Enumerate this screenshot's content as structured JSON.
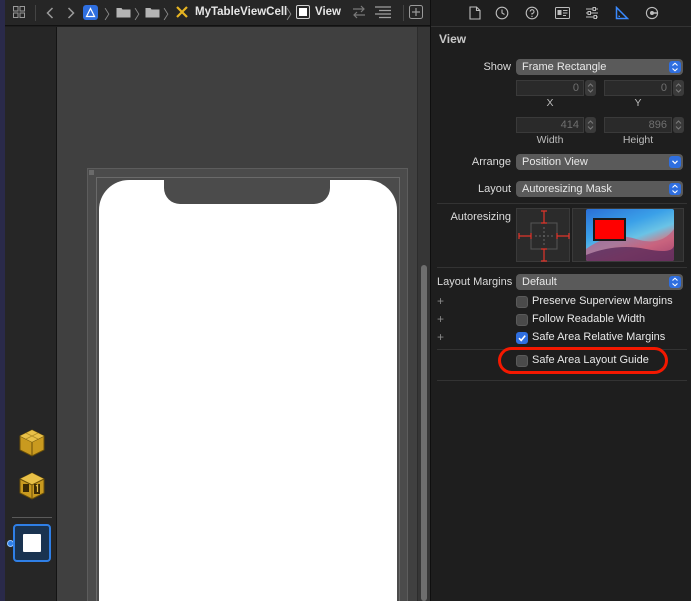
{
  "toolbar": {
    "breadcrumbs": [
      "MyTableViewCell",
      "View"
    ]
  },
  "inspector": {
    "section_title": "View",
    "show": {
      "label": "Show",
      "value": "Frame Rectangle"
    },
    "x": {
      "value": "0",
      "caption": "X"
    },
    "y": {
      "value": "0",
      "caption": "Y"
    },
    "width": {
      "value": "414",
      "caption": "Width"
    },
    "height": {
      "value": "896",
      "caption": "Height"
    },
    "arrange": {
      "label": "Arrange",
      "value": "Position View"
    },
    "layout": {
      "label": "Layout",
      "value": "Autoresizing Mask"
    },
    "autoresizing_label": "Autoresizing",
    "layout_margins": {
      "label": "Layout Margins",
      "value": "Default"
    },
    "checkboxes": [
      {
        "label": "Preserve Superview Margins",
        "checked": false
      },
      {
        "label": "Follow Readable Width",
        "checked": false
      },
      {
        "label": "Safe Area Relative Margins",
        "checked": true
      }
    ],
    "safe_area_guide": {
      "label": "Safe Area Layout Guide",
      "checked": false
    }
  },
  "colors": {
    "accent": "#2f6fe0",
    "selection": "#2f7fe6",
    "highlight_ring": "#f41800",
    "strut": "#e0352b",
    "preview_fill": "#ff0000"
  },
  "icons": {
    "toolbar": [
      "grid-icon",
      "back-chevron-icon",
      "forward-chevron-icon",
      "app-icon",
      "folder-icon",
      "folder-icon",
      "xib-icon",
      "view-icon",
      "swap-arrows-icon",
      "lines-icon",
      "add-editor-icon"
    ],
    "inspector_tabs": [
      "file-icon",
      "history-icon",
      "help-icon",
      "identity-icon",
      "attributes-icon",
      "size-icon",
      "connections-icon"
    ]
  }
}
